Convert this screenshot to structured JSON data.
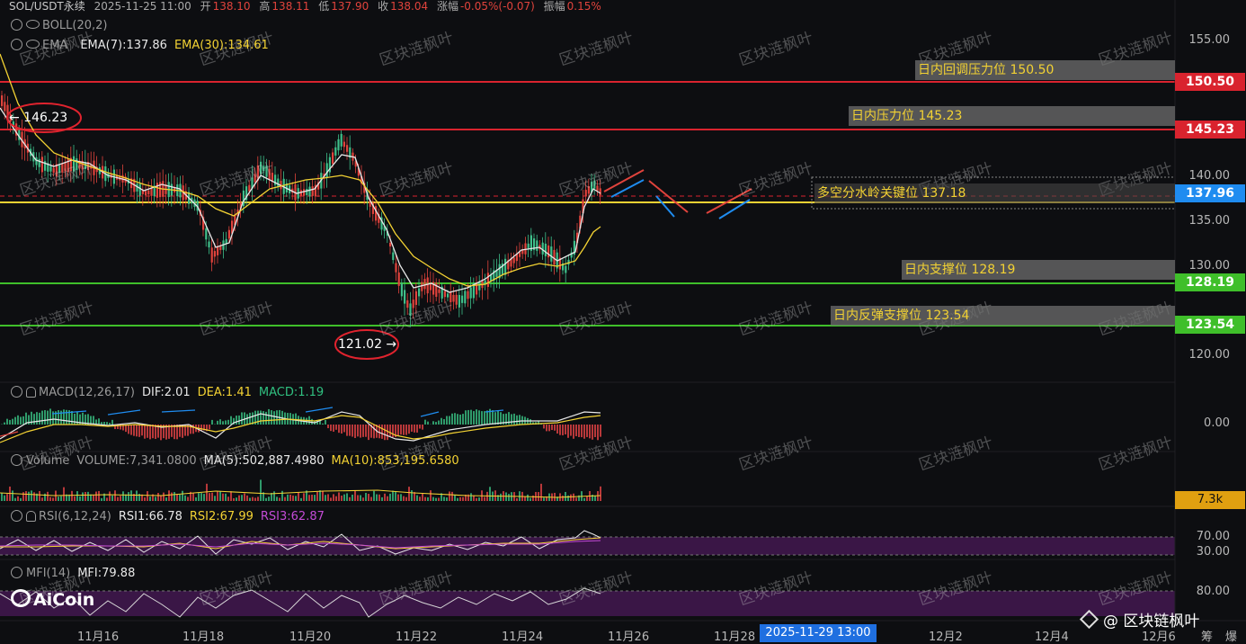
{
  "header": {
    "symbol": "SOL/USDT永续",
    "datetime": "2025-11-25 11:00",
    "open_label": "开",
    "open": "138.10",
    "high_label": "高",
    "high": "138.11",
    "low_label": "低",
    "low": "137.90",
    "close_label": "收",
    "close": "138.04",
    "change_label": "涨幅",
    "change": "-0.05%(-0.07)",
    "amp_label": "振幅",
    "amp": "0.15%"
  },
  "indicators": {
    "boll": "BOLL(20,2)",
    "ema_name": "EMA",
    "ema7": "EMA(7):137.86",
    "ema30": "EMA(30):134.61",
    "macd_name": "MACD(12,26,17)",
    "dif": "DIF:2.01",
    "dea": "DEA:1.41",
    "macd": "MACD:1.19",
    "vol_name": "Volume",
    "vol": "VOLUME:7,341.0800",
    "ma5": "MA(5):502,887.4980",
    "ma10": "MA(10):853,195.6580",
    "rsi_name": "RSI(6,12,24)",
    "rsi1": "RSI1:66.78",
    "rsi2": "RSI2:67.99",
    "rsi3": "RSI3:62.87",
    "mfi_name": "MFI(14)",
    "mfi": "MFI:79.88"
  },
  "price_axis": [
    "155.00",
    "140.00",
    "135.00",
    "130.00",
    "120.00"
  ],
  "levels": [
    {
      "label": "日内回调压力位 150.50",
      "tag": "150.50",
      "color": "#d9232e"
    },
    {
      "label": "日内压力位 145.23",
      "tag": "145.23",
      "color": "#d9232e"
    },
    {
      "label": "多空分水岭关键位 137.18",
      "tag": "137.96",
      "color": "#1f8cf0"
    },
    {
      "label": "日内支撑位 128.19",
      "tag": "128.19",
      "color": "#3fbf2a"
    },
    {
      "label": "日内反弹支撑位 123.54",
      "tag": "123.54",
      "color": "#3fbf2a"
    }
  ],
  "annotations": {
    "high_mark": "← 146.23",
    "low_mark": "121.02 →"
  },
  "macd_axis": "0.00",
  "vol_tag": "7.3k",
  "rsi_axis": [
    "70.00",
    "30.00"
  ],
  "mfi_axis": "80.00",
  "dates": [
    "11月16",
    "11月18",
    "11月20",
    "11月22",
    "11月24",
    "11月26",
    "11月28",
    "12月2",
    "12月4",
    "12月6"
  ],
  "crosshair_date": "2025-11-29 13:00",
  "footer": {
    "logo": "AiCoin",
    "brand": "@ 区块链枫叶",
    "right_a": "筹",
    "right_b": "爆"
  },
  "watermark": "区块涟枫叶"
}
